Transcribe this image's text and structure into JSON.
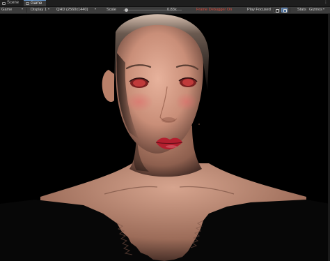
{
  "tabs": [
    {
      "label": "Scene",
      "icon": "scene-icon"
    },
    {
      "label": "Game",
      "icon": "game-icon",
      "active": true
    }
  ],
  "toolbar": {
    "display_mode": "Game",
    "display": "Display 1",
    "resolution": "QHD (2560x1440)",
    "scale_label": "Scale",
    "scale_value": "0.83x",
    "scale_fraction": 0.03,
    "frame_debugger": "Frame Debugger On",
    "play_mode": "Play Focused",
    "stats": "Stats",
    "gizmos": "Gizmos"
  },
  "colors": {
    "accent": "#6a9fd8",
    "frame_debugger": "#d84a3a",
    "toolbar_bg": "#3c3c3c",
    "viewport_bg": "#000000"
  }
}
